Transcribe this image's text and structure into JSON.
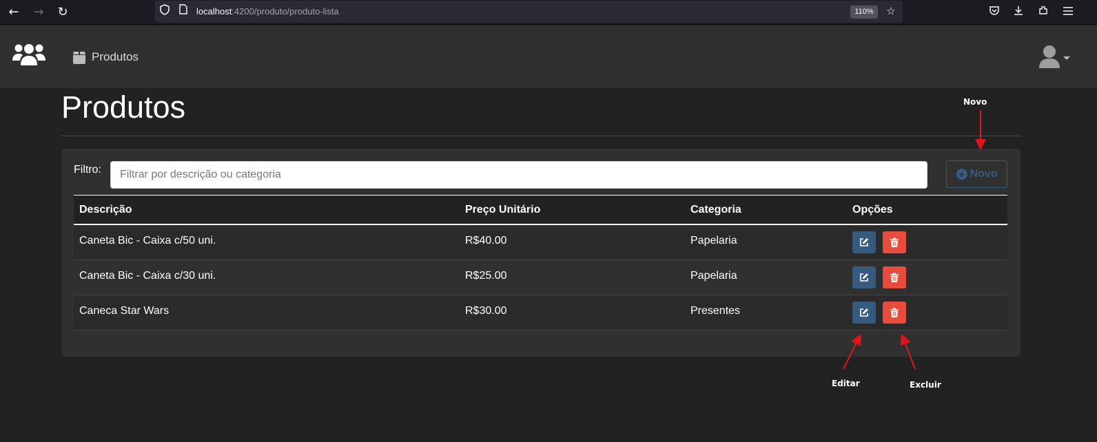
{
  "browser": {
    "url_host": "localhost",
    "url_path": ":4200/produto/produto-lista",
    "zoom": "110%"
  },
  "navbar": {
    "nav_items": [
      {
        "label": "Produtos",
        "icon": "box-icon"
      }
    ]
  },
  "page": {
    "title": "Produtos"
  },
  "filter": {
    "label": "Filtro:",
    "placeholder": "Filtrar por descrição ou categoria",
    "value": ""
  },
  "buttons": {
    "novo_label": "Novo"
  },
  "table": {
    "headers": [
      "Descrição",
      "Preço Unitário",
      "Categoria",
      "Opções"
    ],
    "rows": [
      {
        "descricao": "Caneta Bic - Caixa c/50 uni.",
        "preco": "R$40.00",
        "categoria": "Papelaria"
      },
      {
        "descricao": "Caneta Bic - Caixa c/30 uni.",
        "preco": "R$25.00",
        "categoria": "Papelaria"
      },
      {
        "descricao": "Caneca Star Wars",
        "preco": "R$30.00",
        "categoria": "Presentes"
      }
    ]
  },
  "annotations": {
    "novo": "Novo",
    "editar": "Editar",
    "excluir": "Excluir"
  },
  "colors": {
    "primary": "#375a7f",
    "danger": "#e74c3c",
    "background": "#222222",
    "card": "#303030",
    "annotation_arrow": "#e0151b"
  }
}
